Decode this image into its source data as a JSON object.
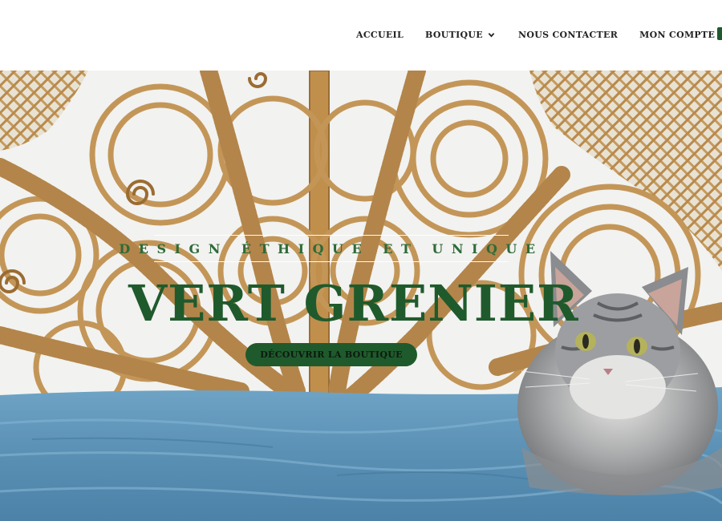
{
  "nav": {
    "items": [
      {
        "label": "ACCUEIL"
      },
      {
        "label": "BOUTIQUE"
      },
      {
        "label": "NOUS CONTACTER"
      },
      {
        "label": "MON COMPTE"
      }
    ],
    "dropdown_icon": "chevron-down-icon",
    "cart_icon": "shopping-basket-icon"
  },
  "hero": {
    "tagline": "DESIGN ÉTHIQUE ET UNIQUE",
    "title": "VERT GRENIER",
    "cta_label": "DÉCOUVRIR LA BOUTIQUE",
    "image_subject": "grey tabby kitten on blue bedspread in front of rattan peacock headboard"
  },
  "colors": {
    "brand_green": "#1f5a2c",
    "tagline_green": "#2e6a38",
    "nav_text": "#222222",
    "rattan": "#c69a5a",
    "bedspread_blue": "#5f95b8"
  }
}
